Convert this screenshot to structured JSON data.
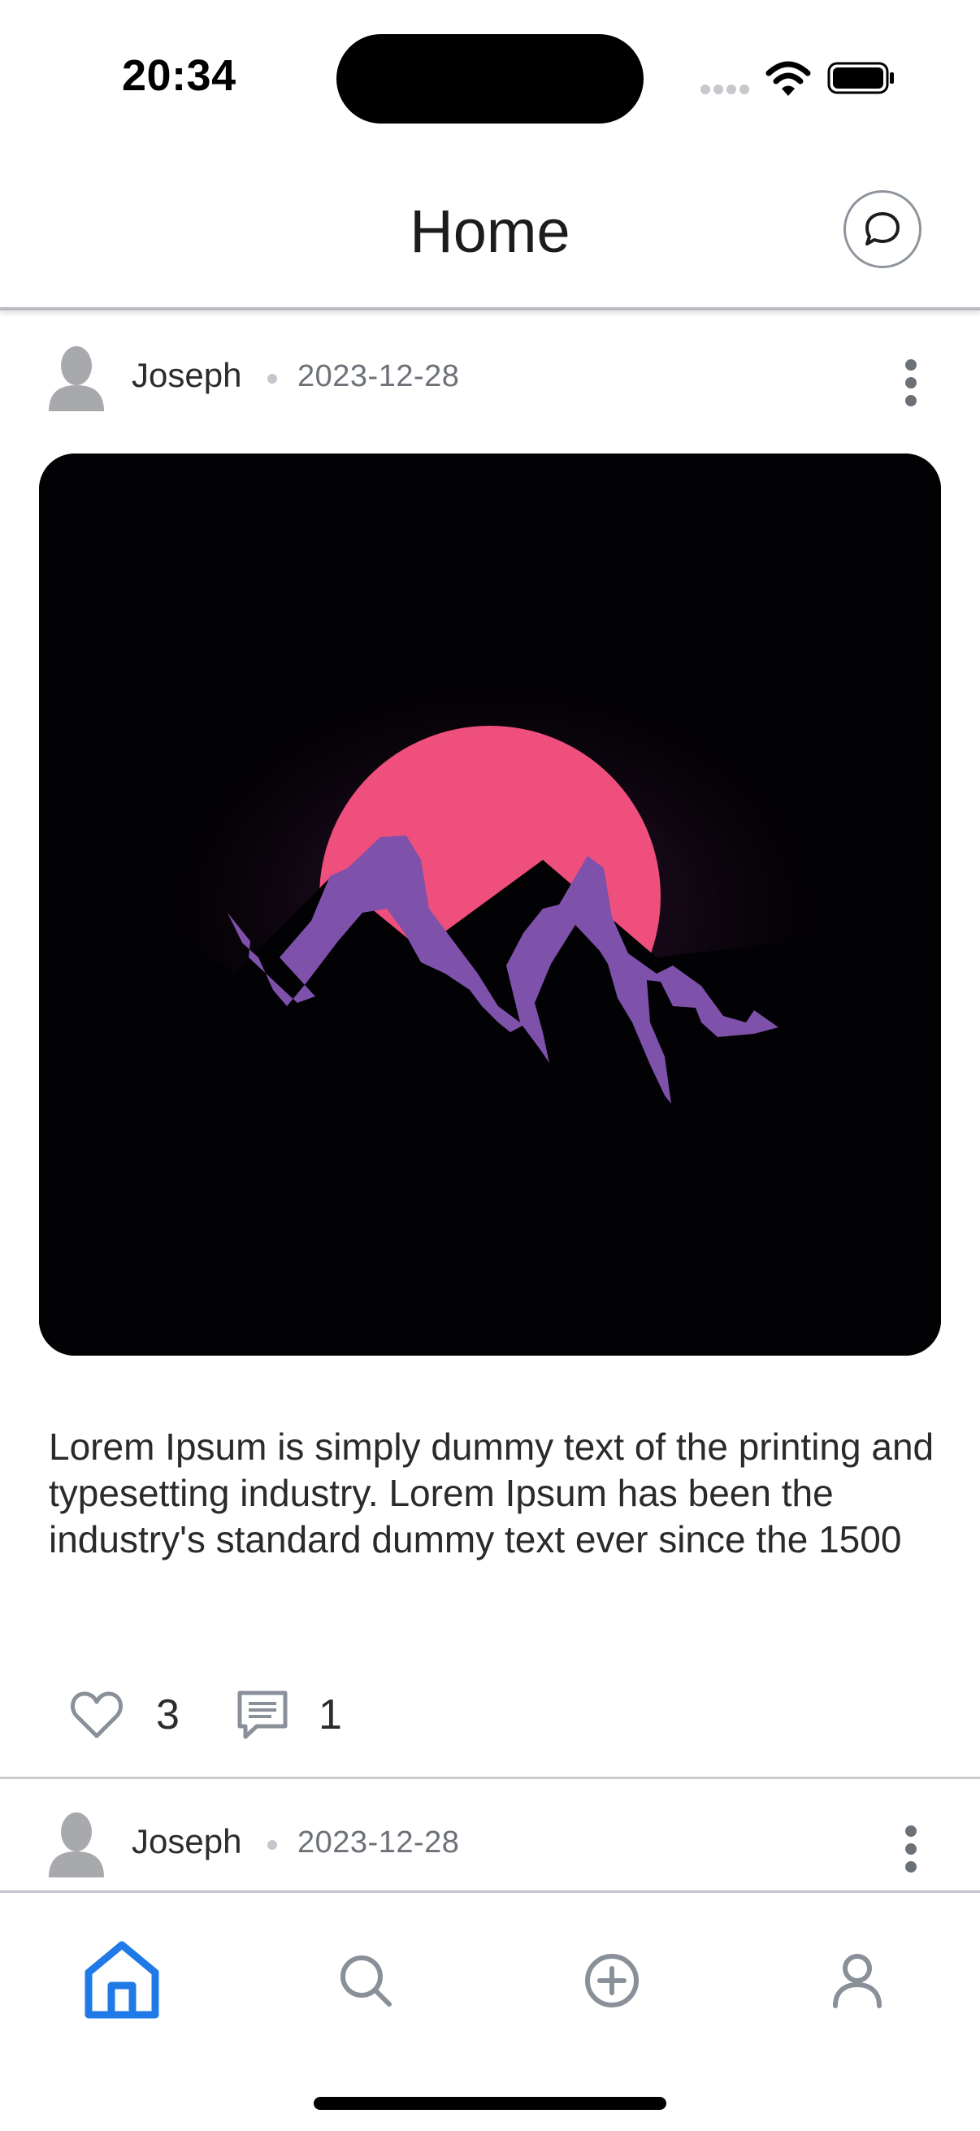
{
  "status_bar": {
    "time": "20:34"
  },
  "header": {
    "title": "Home",
    "chat_icon": "chat-bubble-icon"
  },
  "posts": [
    {
      "author": "Joseph",
      "date": "2023-12-28",
      "image": "mountain-sunset-illustration",
      "text": "Lorem Ipsum is simply dummy text of the printing and typesetting industry. Lorem Ipsum has been the industry's standard dummy text ever since the 1500",
      "likes": "3",
      "comments": "1"
    },
    {
      "author": "Joseph",
      "date": "2023-12-28"
    }
  ],
  "tab_bar": {
    "tabs": [
      {
        "icon": "home-icon",
        "active": true
      },
      {
        "icon": "search-icon",
        "active": false
      },
      {
        "icon": "add-circle-icon",
        "active": false
      },
      {
        "icon": "profile-icon",
        "active": false
      }
    ]
  },
  "colors": {
    "accent": "#1f7ae8",
    "icon_gray": "#8a9099",
    "sun": "#ee4f7d",
    "mountain": "#7e51ab"
  }
}
